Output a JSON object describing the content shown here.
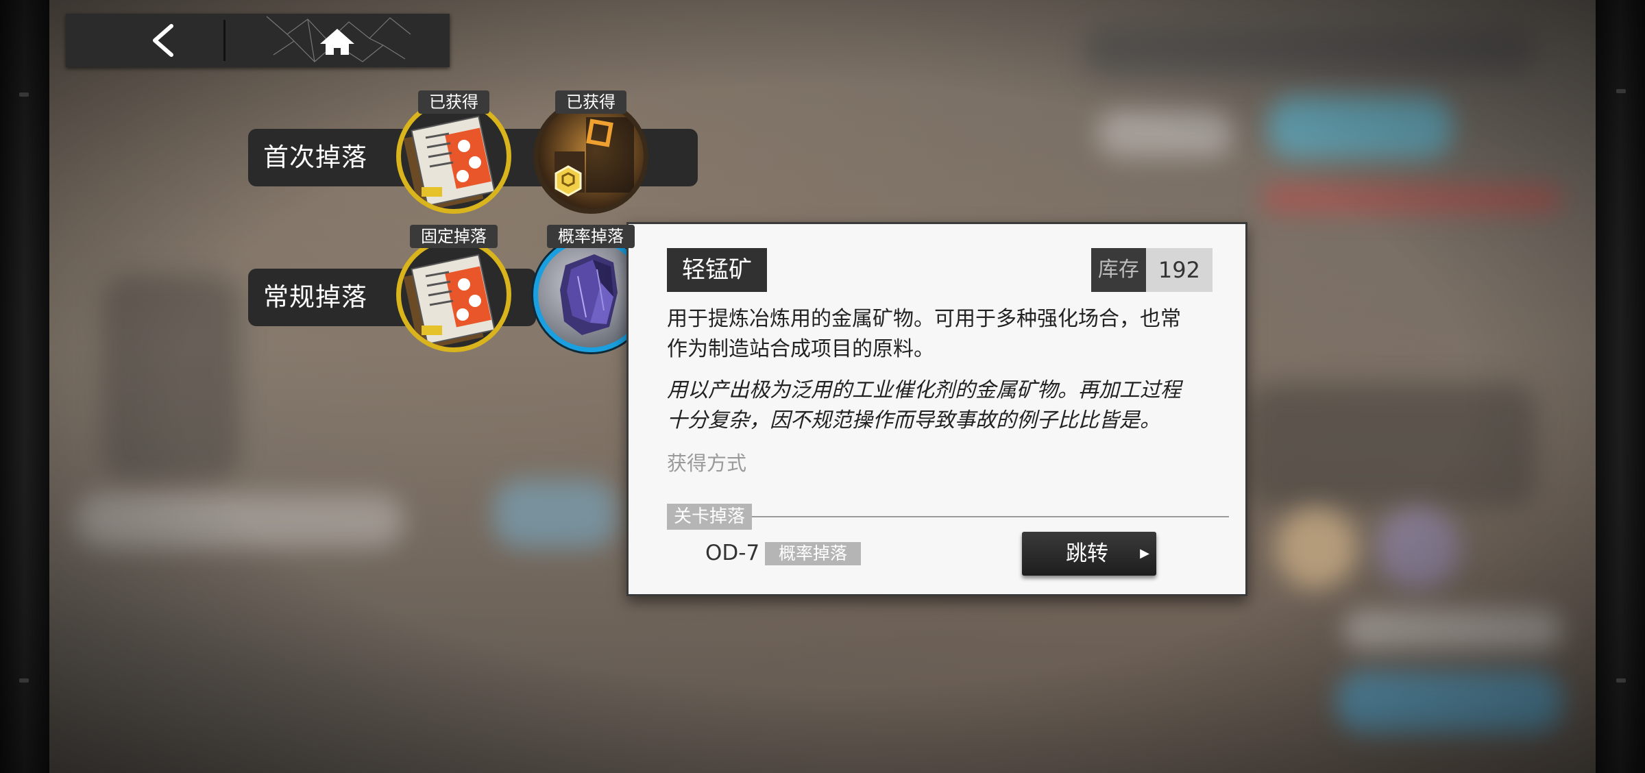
{
  "nav": {
    "back_icon": "chevron-left-icon",
    "home_icon": "home-icon"
  },
  "drops": {
    "first": {
      "label": "首次掉落",
      "items": [
        {
          "tag": "已获得",
          "icon": "document-item-icon",
          "ring_color": "#d9b41c"
        },
        {
          "tag": "已获得",
          "icon": "furniture-item-icon",
          "ring_color": "#3a2a1a"
        }
      ]
    },
    "regular": {
      "label": "常规掉落",
      "items": [
        {
          "tag": "固定掉落",
          "icon": "document-item-icon",
          "ring_color": "#d9b41c"
        },
        {
          "tag": "概率掉落",
          "icon": "manganese-ore-icon",
          "ring_color": "#1aa0e0"
        }
      ]
    }
  },
  "popup": {
    "item_name": "轻锰矿",
    "stock_label": "库存",
    "stock_value": "192",
    "description_line1": "用于提炼冶炼用的金属矿物。可用于多种强化场合，也常",
    "description_line2": "作为制造站合成项目的原料。",
    "lore_line1": "用以产出极为泛用的工业催化剂的金属矿物。再加工过程",
    "lore_line2": "十分复杂，因不规范操作而导致事故的例子比比皆是。",
    "obtain_title": "获得方式",
    "stage_tag": "关卡掉落",
    "stage_code": "OD-7",
    "stage_drop_type": "概率掉落",
    "jump_label": "跳转"
  }
}
